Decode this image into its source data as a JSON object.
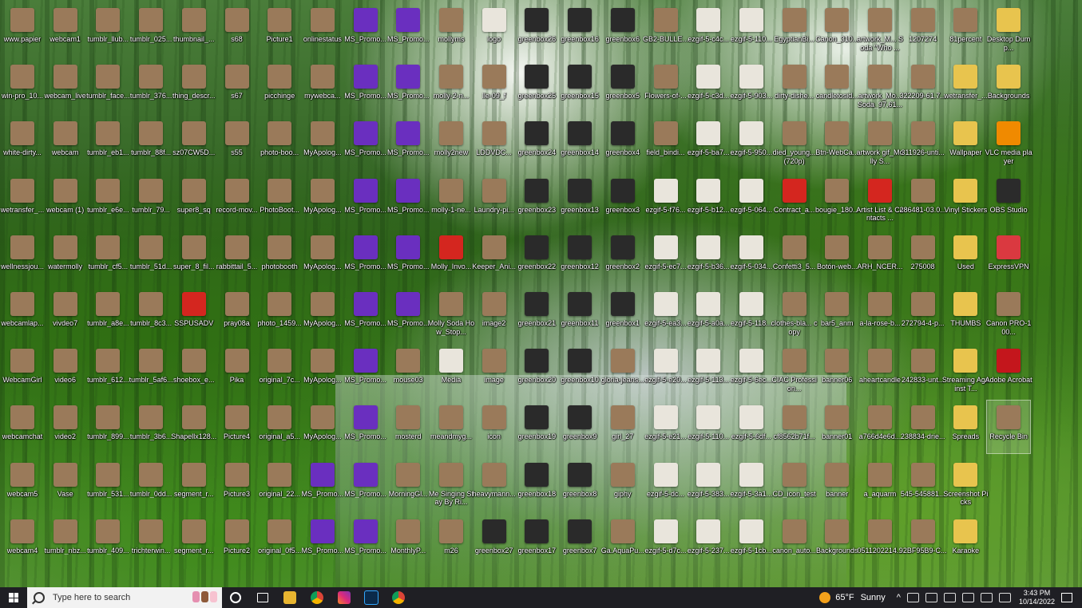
{
  "desktop": {
    "columns": [
      [
        "www.papier",
        "win-pro_10...",
        "white-dirty...",
        "wetransfer_...",
        "wellnessjou...",
        "webcamlap...",
        "WebcamGirl",
        "webcamchat",
        "webcam5",
        "webcam4"
      ],
      [
        "webcam1",
        "webcam_live",
        "webcam",
        "webcam (1)",
        "watermolly",
        "vivdeo7",
        "video6",
        "video2",
        "Vase",
        "tumblr_nbz..."
      ],
      [
        "tumblr_llub...",
        "tumblr_face...",
        "tumblr_eb1...",
        "tumblr_e6e...",
        "tumblr_cf5...",
        "tumblr_a8e...",
        "tumblr_612...",
        "tumblr_899...",
        "tumblr_531...",
        "tumblr_409..."
      ],
      [
        "tumblr_025...",
        "tumblr_376...",
        "tumblr_88f...",
        "tumblr_79...",
        "tumblr_51d...",
        "tumblr_8c3...",
        "tumblr_5af6...",
        "tumblr_3b6...",
        "tumblr_0dd...",
        "trichterwin..."
      ],
      [
        "thumbnail_...",
        "thing_descr...",
        "sz07CW5D...",
        "super8_sq",
        "super_8_fil...",
        "SSPUSADV",
        "shoebox_e...",
        "Shapellx128...",
        "segment_r...",
        "segment_r..."
      ],
      [
        "s68",
        "s67",
        "s55",
        "record-mov...",
        "rabbittail_5...",
        "pray08a",
        "Pika",
        "Picture4",
        "Picture3",
        "Picture2"
      ],
      [
        "Picture1",
        "picchinge",
        "photo-boo...",
        "PhotoBoot...",
        "photobooth",
        "photo_1459...",
        "original_7c...",
        "original_a5...",
        "original_22...",
        "original_0f5..."
      ],
      [
        "onlinestatus",
        "mywebca...",
        "MyApolog...",
        "MyApolog...",
        "MyApolog...",
        "MyApolog...",
        "MyApolog...",
        "MyApolog...",
        "MS_Promo...",
        "MS_Promo..."
      ],
      [
        "MS_Promo...",
        "MS_Promo...",
        "MS_Promo...",
        "MS_Promo...",
        "MS_Promo...",
        "MS_Promo...",
        "MS_Promo...",
        "MS_Promo...",
        "MS_Promo...",
        "MS_Promo..."
      ],
      [
        "MS_Promo...",
        "MS_Promo...",
        "MS_Promo...",
        "MS_Promo...",
        "MS_Promo...",
        "MS_Promo...",
        "mouse03",
        "mosterd",
        "MorningGl...",
        "MonthlyP..."
      ],
      [
        "mollyms",
        "molly-2-n...",
        "molly2new",
        "molly-1-ne...",
        "Molly_Invo...",
        "Molly Soda How_Stop...",
        "Media",
        "meandmyg...",
        "Me Singing Stay By Ri...",
        "m26"
      ],
      [
        "logo",
        "lle-09_f",
        "LDDVDC...",
        "Laundry-pi...",
        "Keeper_Ani...",
        "image2",
        "image",
        "icon",
        "heavymann...",
        "greenbox27"
      ],
      [
        "greenbox26",
        "greenbox25",
        "greenbox24",
        "greenbox23",
        "greenbox22",
        "greenbox21",
        "greenbox20",
        "greenbox19",
        "greenbox18",
        "greenbox17"
      ],
      [
        "greenbox16",
        "greenbox15",
        "greenbox14",
        "greenbox13",
        "greenbox12",
        "greenbox11",
        "greenbox10",
        "greenbox9",
        "greenbox8",
        "greenbox7"
      ],
      [
        "greenbox6",
        "greenbox5",
        "greenbox4",
        "greenbox3",
        "greenbox2",
        "greenbox1",
        "gloria-jeans...",
        "girl_27",
        "giphy",
        "Ga.AquaPu..."
      ],
      [
        "GB2-BULLE...",
        "Flowers-of-...",
        "field_bindi...",
        "ezgif-5-f76...",
        "ezgif-5-ec7...",
        "ezgif-5-ea3...",
        "ezgif-5-e20...",
        "ezgif-5-e21...",
        "ezgif-5-dc...",
        "ezgif-5-d7c..."
      ],
      [
        "ezgif-5-c4c...",
        "ezgif-5-c3d...",
        "ezgif-5-ba7...",
        "ezgif-5-b12...",
        "ezgif-5-b36...",
        "ezgif-5-a0a...",
        "ezgif-5-113...",
        "ezgif-5-110...",
        "ezgif-5-383...",
        "ezgif-5-237..."
      ],
      [
        "ezgif-5-110...",
        "ezgif-5-903...",
        "ezgif-5-950...",
        "ezgif-5-064...",
        "ezgif-5-034...",
        "ezgif-5-118...",
        "ezgif-5-6ec...",
        "ezgif-5-6df...",
        "ezgif-5-3a1...",
        "ezgif-5-1cb..."
      ],
      [
        "EgyptianBi...",
        "dirty-dishe...",
        "died_young... (720p)",
        "Contract_a...",
        "Confetti3_5...",
        "clothes-bla... copy",
        "CIAC Profession...",
        "cf8562b71f...",
        "CD_icon_test",
        "canon_auto..."
      ],
      [
        "Canon_310...",
        "candletosid...",
        "Btn-WebCa...",
        "bougie_180...",
        "Botón-web...",
        "bar5_anm",
        "banner06",
        "banner01",
        "banner",
        "Backgrounds"
      ],
      [
        "artwork_M... Soda \"Who ...",
        "artwork_Mo... Soda_97,61...",
        "artwork gif_Molly S...",
        "Artist List & Contacts ...",
        "ARH_NCER...",
        "a-la-rose-b...",
        "aheartcandle",
        "a766d4e6d...",
        "a_aquarm",
        "0511202214..."
      ],
      [
        "1207274",
        "322209-61.7...",
        "311926-unti...",
        "286481-03.0...",
        "275008",
        "272794-4-p...",
        "242833-unt...",
        "238834-drie...",
        "545-545881...",
        "92BF95B9-C..."
      ],
      [
        "81percent",
        "wetransfer_...",
        "Wallpaper",
        "Vinyl Stickers",
        "Used",
        "THUMBS",
        "Streaming Against T...",
        "Spreads",
        "Screenshot Picks",
        "Karaoke"
      ],
      [
        "Desktop Dump...",
        "Backgrounds",
        "VLC media player",
        "OBS Studio",
        "ExpressVPN",
        "Canon PRO-100...",
        "Adobe Acrobat",
        "Recycle Bin"
      ]
    ]
  },
  "colors": {
    "folder": "#e8c44e",
    "pdf": "#d4261f",
    "vlc": "#f08a00",
    "obs": "#2b2b2b",
    "expressvpn": "#da3940",
    "acrobat": "#c4161c",
    "greenbox": "#2a2a2a",
    "ms_promo": "#6a2fbf",
    "photo": "#9a7a5a",
    "light": "#e9e5dc"
  },
  "taskbar": {
    "search_placeholder": "Type here to search",
    "apps": [
      "task-view-icon",
      "file-explorer-icon",
      "chrome-icon",
      "instagram-icon",
      "photoshop-icon",
      "chrome-profile-icon"
    ],
    "weather_temp": "65°F",
    "weather_cond": "Sunny",
    "time": "3:43 PM",
    "date": "10/14/2022"
  }
}
